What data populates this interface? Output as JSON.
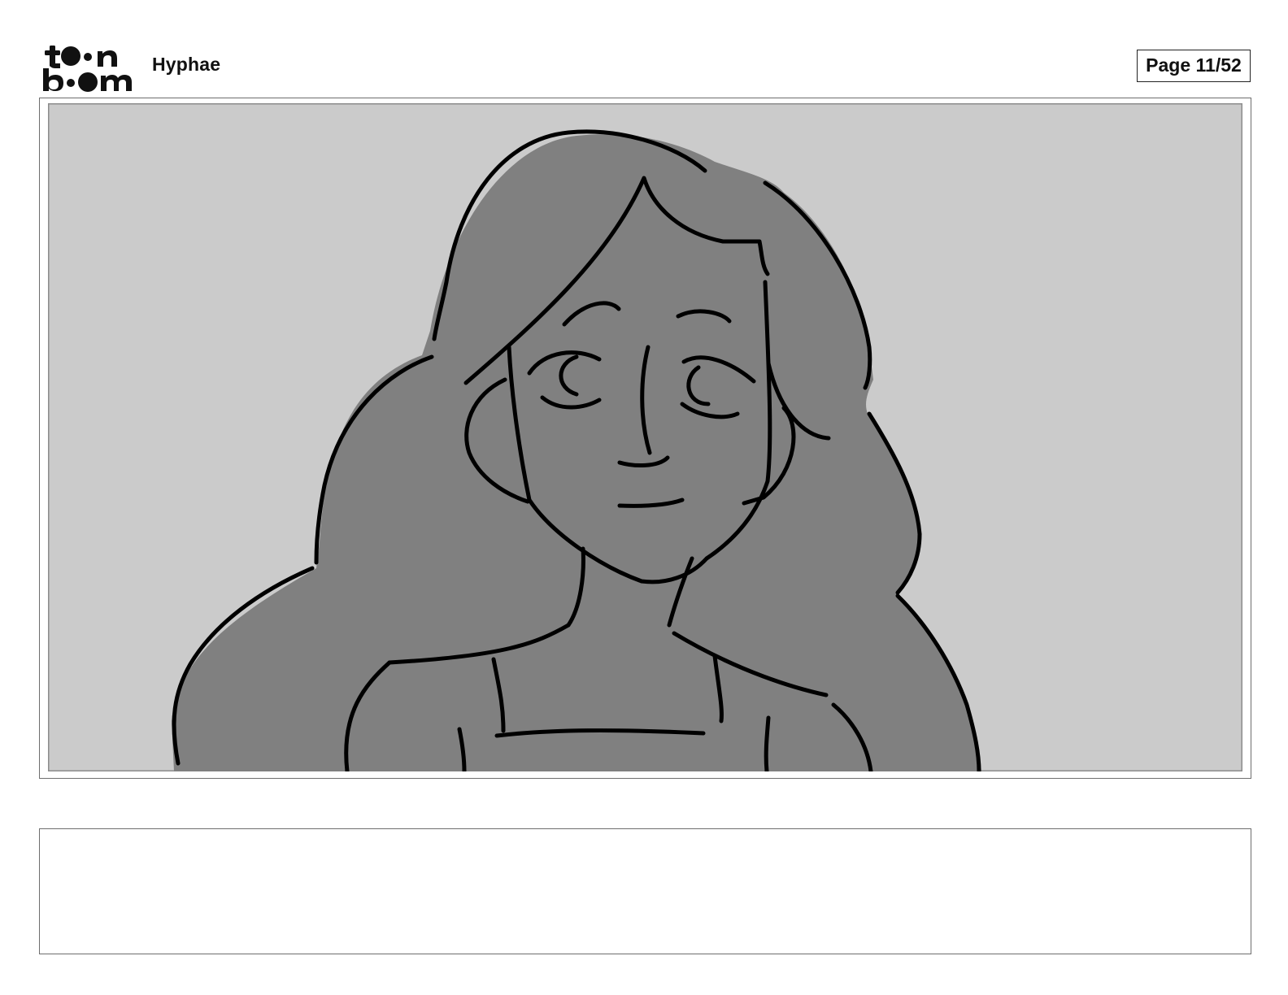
{
  "header": {
    "logo_name": "toon boom logo",
    "project_title": "Hyphae",
    "page_label": "Page 11/52"
  },
  "panel": {
    "background_color": "#cbcbcb",
    "figure_fill_color": "#808080",
    "line_color": "#000000"
  },
  "notes": {
    "text": ""
  }
}
